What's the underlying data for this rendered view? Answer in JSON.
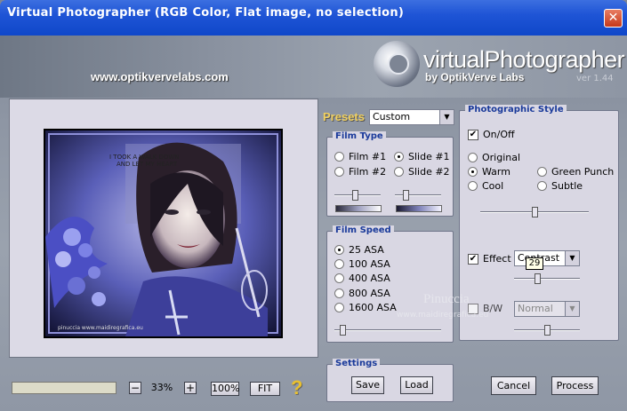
{
  "window": {
    "title": "Virtual Photographer (RGB Color, Flat image, no selection)",
    "close_glyph": "✕"
  },
  "header": {
    "website": "www.optikvervelabs.com",
    "logo_text": "virtualPhotographer",
    "logo_by": "by OptikVerve Labs",
    "version": "ver 1.44"
  },
  "presets": {
    "label": "Presets",
    "value": "Custom"
  },
  "film_type": {
    "title": "Film Type",
    "options": [
      {
        "label": "Film #1",
        "selected": false
      },
      {
        "label": "Slide #1",
        "selected": true
      },
      {
        "label": "Film #2",
        "selected": false
      },
      {
        "label": "Slide #2",
        "selected": false
      }
    ]
  },
  "film_speed": {
    "title": "Film Speed",
    "options": [
      {
        "label": "25 ASA",
        "selected": true
      },
      {
        "label": "100 ASA",
        "selected": false
      },
      {
        "label": "400 ASA",
        "selected": false
      },
      {
        "label": "800 ASA",
        "selected": false
      },
      {
        "label": "1600 ASA",
        "selected": false
      }
    ]
  },
  "photographic_style": {
    "title": "Photographic Style",
    "on_off_label": "On/Off",
    "on_off_checked": true,
    "styles": [
      {
        "label": "Original",
        "selected": false
      },
      {
        "label": "Warm",
        "selected": true
      },
      {
        "label": "Green Punch",
        "selected": false
      },
      {
        "label": "Cool",
        "selected": false
      },
      {
        "label": "Subtle",
        "selected": false
      }
    ],
    "effect_label": "Effect",
    "effect_checked": true,
    "effect_value": "Contrast",
    "effect_tooltip": "29",
    "bw_label": "B/W",
    "bw_value": "Normal"
  },
  "settings": {
    "title": "Settings",
    "save_label": "Save",
    "load_label": "Load"
  },
  "zoom": {
    "minus": "−",
    "value": "33%",
    "plus": "+",
    "hundred": "100%",
    "fit": "FIT",
    "help": "?"
  },
  "actions": {
    "cancel_label": "Cancel",
    "process_label": "Process"
  },
  "watermark": {
    "name": "Pinuccia",
    "site": "www.maidiregrafica.eu"
  },
  "image_text": {
    "quote_line1": "I TOOK A WALK DOWN",
    "quote_line2": "AND LET MY HEART",
    "credit": "pinuccia www.maidiregrafica.eu"
  },
  "colors": {
    "title_bar": "#1f55d6",
    "panel_bg": "#d9d7e3",
    "panel_label": "#1a3a9a",
    "presets_label": "#f0d060"
  },
  "levels": {
    "film_type_left": 0.45,
    "film_type_right": 0.2,
    "style_slider": 0.5,
    "effect_slider": 0.35,
    "bw_slider": 0.5,
    "film_speed_slider": 0.05
  }
}
